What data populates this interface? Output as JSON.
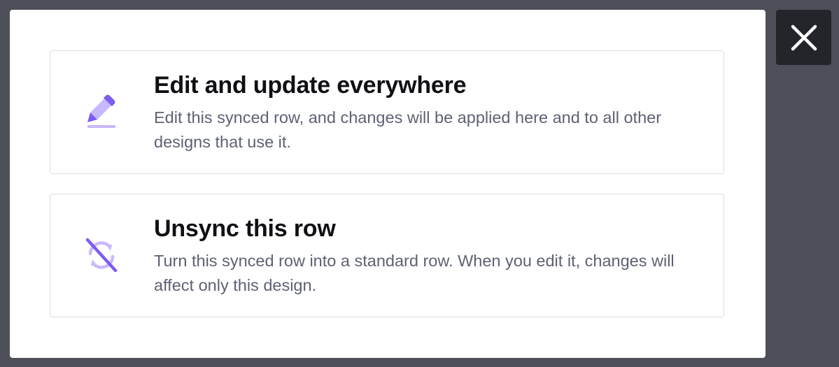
{
  "dialog": {
    "options": [
      {
        "icon": "pencil-icon",
        "title": "Edit and update everywhere",
        "description": "Edit this synced row, and changes will be applied here and to all other designs that use it."
      },
      {
        "icon": "unsync-icon",
        "title": "Unsync this row",
        "description": "Turn this synced row into a standard row. When you edit it, changes will affect only this design."
      }
    ],
    "close_icon": "close-icon"
  },
  "colors": {
    "overlay": "#4d5059",
    "close_button_bg": "#23252b",
    "icon_primary": "#7d5cf0",
    "icon_light": "#c8b8ff",
    "title": "#0f1014",
    "description": "#5d6273",
    "card_border": "#dcdde2"
  }
}
